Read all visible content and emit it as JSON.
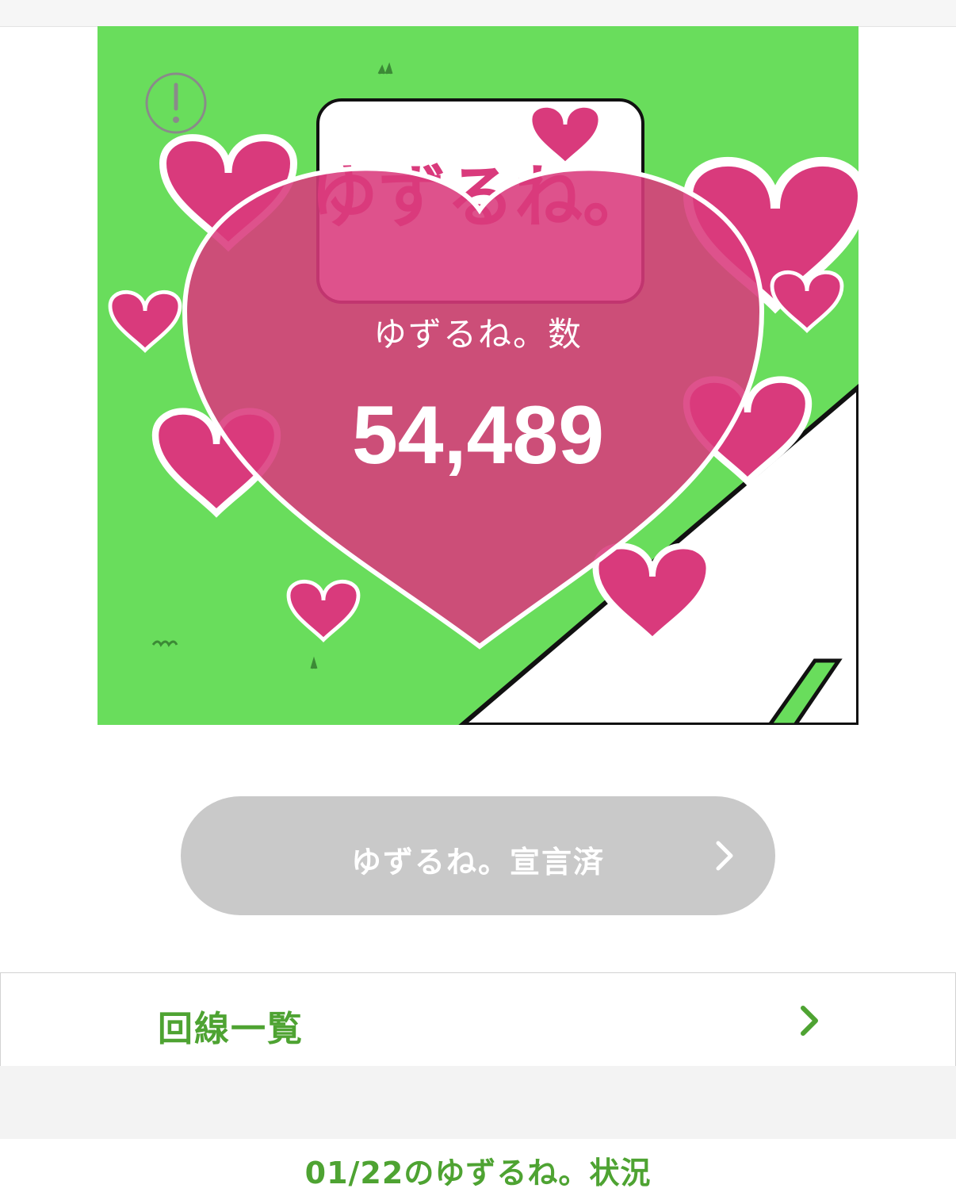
{
  "hero": {
    "counter_label": "ゆずるね。数",
    "counter_value": "54,489",
    "sign_text": "ゆずるね。",
    "colors": {
      "background_green": "#69dd5c",
      "heart_pink": "#d93a7c",
      "road_white": "#ffffff"
    }
  },
  "declare_button": {
    "label": "ゆずるね。宣言済",
    "icon": "chevron-right-icon"
  },
  "lines_row": {
    "label": "回線一覧",
    "icon": "chevron-right-icon"
  },
  "status_section": {
    "title": "01/22のゆずるね。状況"
  },
  "colors": {
    "accent_green": "#4ea332",
    "button_disabled": "#c9c9c9"
  }
}
